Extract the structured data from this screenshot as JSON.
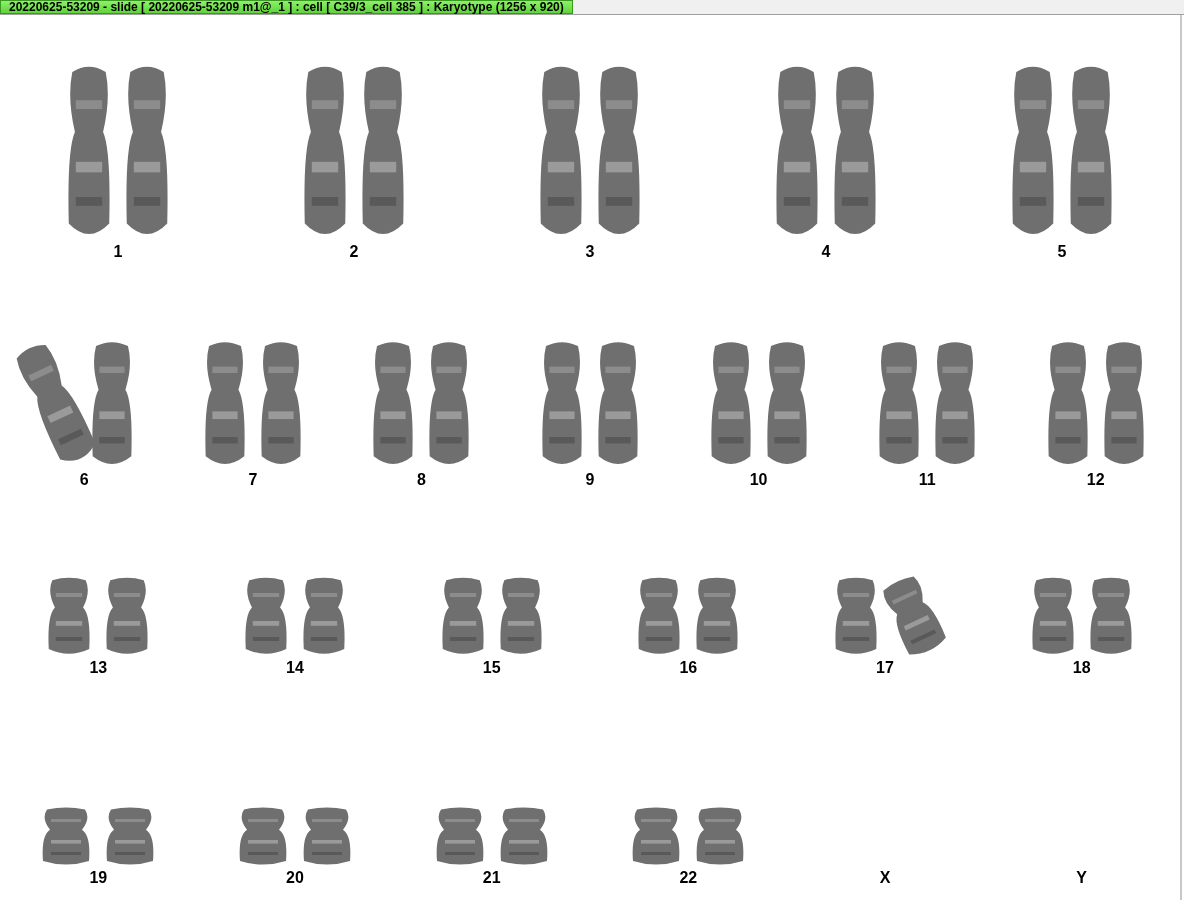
{
  "window": {
    "title": "20220625-53209 - slide [ 20220625-53209 m1@_1 ] : cell [ C39/3_cell 385 ] : Karyotype  (1256 x 920)"
  },
  "karyotype": {
    "rows": [
      {
        "groups": [
          {
            "label": "1",
            "chromosomes": [
              {
                "kind": "straight"
              },
              {
                "kind": "straight"
              }
            ]
          },
          {
            "label": "2",
            "chromosomes": [
              {
                "kind": "straight"
              },
              {
                "kind": "straight"
              }
            ]
          },
          {
            "label": "3",
            "chromosomes": [
              {
                "kind": "straight"
              },
              {
                "kind": "straight"
              }
            ]
          },
          {
            "label": "4",
            "chromosomes": [
              {
                "kind": "straight"
              },
              {
                "kind": "straight"
              }
            ]
          },
          {
            "label": "5",
            "chromosomes": [
              {
                "kind": "straight"
              },
              {
                "kind": "straight"
              }
            ]
          }
        ]
      },
      {
        "groups": [
          {
            "label": "6",
            "chromosomes": [
              {
                "kind": "tilted"
              },
              {
                "kind": "straight"
              }
            ]
          },
          {
            "label": "7",
            "chromosomes": [
              {
                "kind": "straight"
              },
              {
                "kind": "straight"
              }
            ]
          },
          {
            "label": "8",
            "chromosomes": [
              {
                "kind": "straight"
              },
              {
                "kind": "straight"
              }
            ]
          },
          {
            "label": "9",
            "chromosomes": [
              {
                "kind": "straight"
              },
              {
                "kind": "straight"
              }
            ]
          },
          {
            "label": "10",
            "chromosomes": [
              {
                "kind": "straight"
              },
              {
                "kind": "straight"
              }
            ]
          },
          {
            "label": "11",
            "chromosomes": [
              {
                "kind": "straight"
              },
              {
                "kind": "straight"
              }
            ]
          },
          {
            "label": "12",
            "chromosomes": [
              {
                "kind": "straight"
              },
              {
                "kind": "straight"
              }
            ]
          }
        ]
      },
      {
        "groups": [
          {
            "label": "13",
            "chromosomes": [
              {
                "kind": "straight"
              },
              {
                "kind": "straight"
              }
            ]
          },
          {
            "label": "14",
            "chromosomes": [
              {
                "kind": "straight"
              },
              {
                "kind": "straight"
              }
            ]
          },
          {
            "label": "15",
            "chromosomes": [
              {
                "kind": "straight"
              },
              {
                "kind": "straight"
              }
            ]
          },
          {
            "label": "16",
            "chromosomes": [
              {
                "kind": "straight"
              },
              {
                "kind": "straight"
              }
            ]
          },
          {
            "label": "17",
            "chromosomes": [
              {
                "kind": "straight"
              },
              {
                "kind": "tilted"
              }
            ]
          },
          {
            "label": "18",
            "chromosomes": [
              {
                "kind": "straight"
              },
              {
                "kind": "straight"
              }
            ]
          }
        ]
      },
      {
        "groups": [
          {
            "label": "19",
            "chromosomes": [
              {
                "kind": "straight"
              },
              {
                "kind": "straight"
              }
            ]
          },
          {
            "label": "20",
            "chromosomes": [
              {
                "kind": "straight"
              },
              {
                "kind": "straight"
              }
            ]
          },
          {
            "label": "21",
            "chromosomes": [
              {
                "kind": "straight"
              },
              {
                "kind": "straight"
              }
            ]
          },
          {
            "label": "22",
            "chromosomes": [
              {
                "kind": "straight"
              },
              {
                "kind": "straight"
              }
            ]
          },
          {
            "label": "X"
          },
          {
            "label": "Y"
          }
        ]
      }
    ]
  }
}
